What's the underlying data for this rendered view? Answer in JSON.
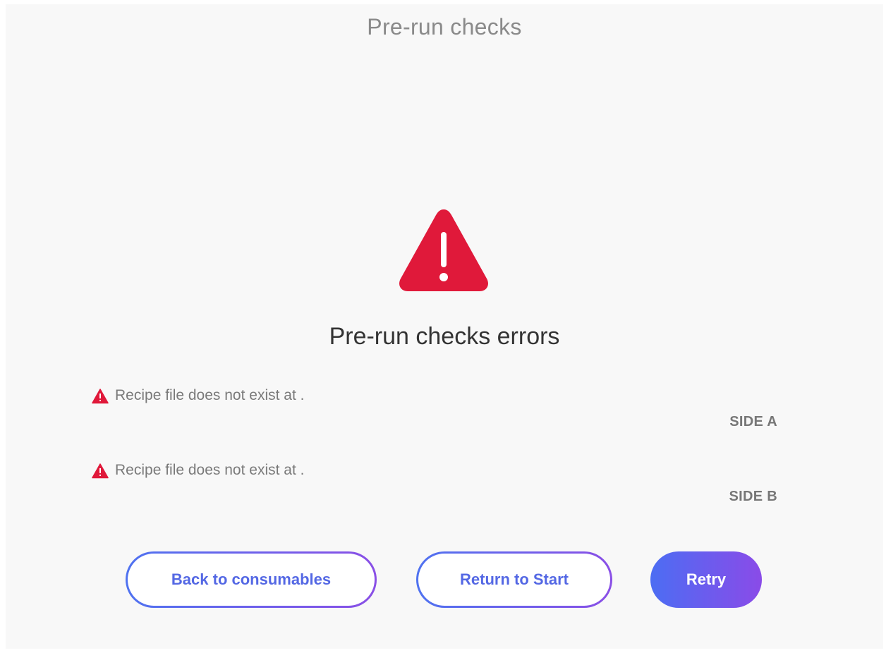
{
  "page": {
    "title": "Pre-run checks",
    "error_heading": "Pre-run checks errors"
  },
  "errors": [
    {
      "message": "Recipe file does not exist at .",
      "side": "SIDE A"
    },
    {
      "message": "Recipe file does not exist at .",
      "side": "SIDE B"
    }
  ],
  "buttons": {
    "back_label": "Back to consumables",
    "return_label": "Return to Start",
    "retry_label": "Retry"
  },
  "icons": {
    "large": "warning-triangle-icon",
    "small": "warning-triangle-icon"
  },
  "colors": {
    "error_red": "#e0193a",
    "accent_blue": "#4f72f0",
    "accent_purple": "#8a4fe6"
  }
}
